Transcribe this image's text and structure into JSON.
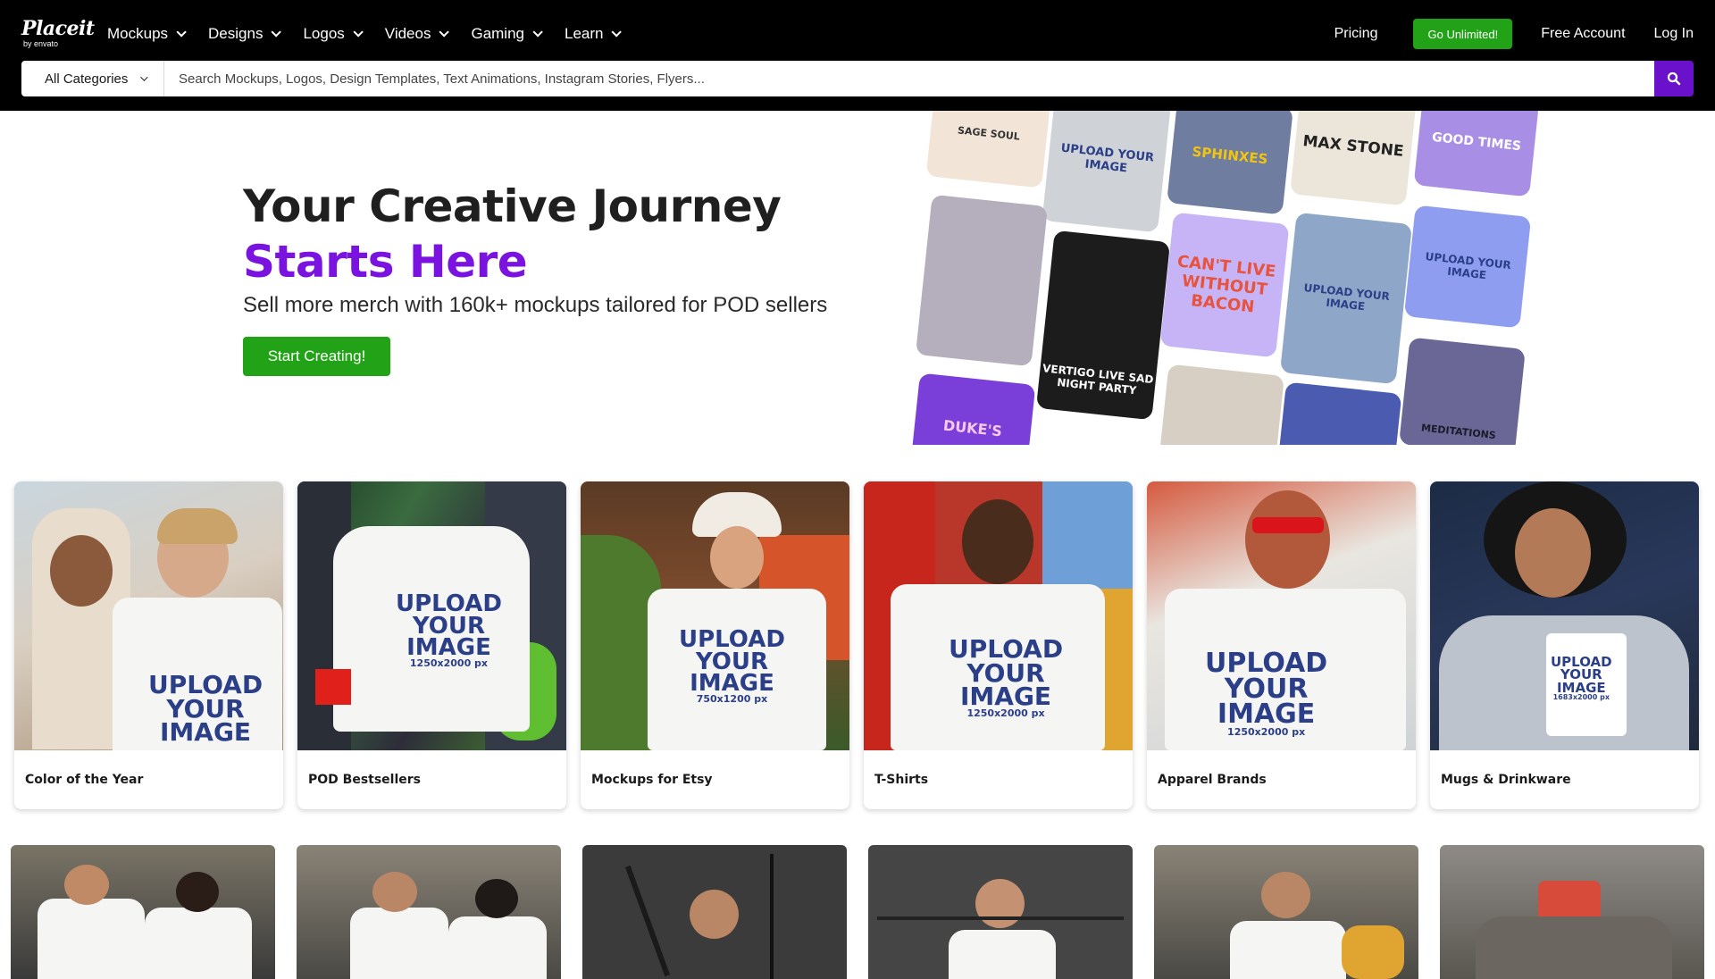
{
  "brand": {
    "logo_word": "Placeit",
    "logo_sub": "by envato"
  },
  "nav": {
    "menu": [
      {
        "label": "Mockups"
      },
      {
        "label": "Designs"
      },
      {
        "label": "Logos"
      },
      {
        "label": "Videos"
      },
      {
        "label": "Gaming"
      },
      {
        "label": "Learn"
      }
    ],
    "pricing": "Pricing",
    "go_unlimited": "Go Unlimited!",
    "free_account": "Free Account",
    "login": "Log In"
  },
  "search": {
    "category": "All Categories",
    "placeholder": "Search Mockups, Logos, Design Templates, Text Animations, Instagram Stories, Flyers..."
  },
  "hero": {
    "title_line1": "Your Creative Journey",
    "title_line2": "Starts Here",
    "subtitle": "Sell more merch with 160k+ mockups tailored for POD sellers",
    "cta": "Start Creating!"
  },
  "collage": {
    "tiles": [
      {
        "text": "SAGE SOUL"
      },
      {
        "text": "UPLOAD YOUR IMAGE"
      },
      {
        "text": "SPHINXES"
      },
      {
        "text": "MAX STONE"
      },
      {
        "text": "GOOD TIMES"
      },
      {
        "text": "CAN'T LIVE WITHOUT BACON"
      },
      {
        "text": "VERTIGO LIVE SAD NIGHT PARTY"
      },
      {
        "text": "UPLOAD YOUR IMAGE"
      },
      {
        "text": "UPLOAD YOUR IMAGE"
      },
      {
        "text": "DUKE'S"
      },
      {
        "text": "MEDITATIONS"
      }
    ]
  },
  "categories": [
    {
      "label": "Color of the Year"
    },
    {
      "label": "POD Bestsellers"
    },
    {
      "label": "Mockups for Etsy"
    },
    {
      "label": "T-Shirts"
    },
    {
      "label": "Apparel Brands"
    },
    {
      "label": "Mugs & Drinkware"
    }
  ],
  "mockup_text": {
    "upload": "UPLOAD",
    "your": "YOUR",
    "image": "IMAGE",
    "size_shirt": "1250x2000 px",
    "size_etsy": "750x1200 px",
    "size_mug": "1683x2000 px"
  },
  "colors": {
    "nav_bg": "#000000",
    "accent_green": "#22a317",
    "accent_purple": "#7a13e0",
    "search_button": "#6a11cb"
  }
}
